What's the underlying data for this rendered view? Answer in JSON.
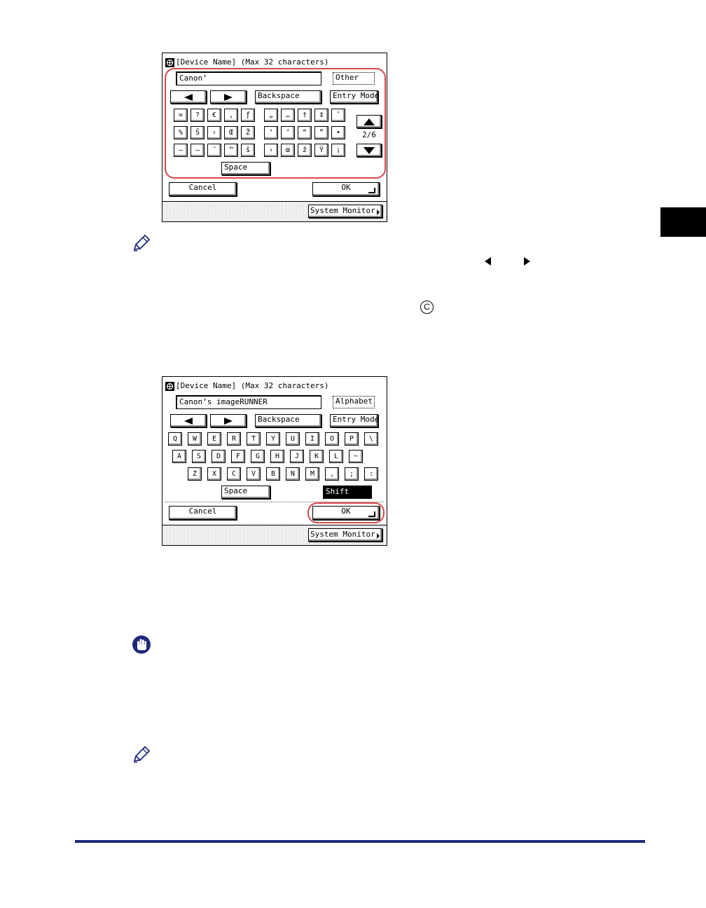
{
  "screen1": {
    "title": "[Device Name] (Max 32 characters)",
    "input_value": "Canon’",
    "mode_label": "Other",
    "backspace_label": "Backspace",
    "entry_mode_label": "Entry Mode",
    "page_indicator": "2/6",
    "keys_row1": [
      "=",
      "?",
      "€",
      ",",
      "ƒ",
      "„",
      "…",
      "†",
      "‡",
      "ˆ"
    ],
    "keys_row2": [
      "%",
      "Š",
      "‹",
      "Œ",
      "Ž",
      "‘",
      "’",
      "“",
      "”",
      "•"
    ],
    "keys_row3": [
      "–",
      "—",
      "˜",
      "™",
      "š",
      "›",
      "œ",
      "ž",
      "Ÿ",
      "¡"
    ],
    "space_label": "Space",
    "cancel_label": "Cancel",
    "ok_label": "OK",
    "system_monitor_label": "System Monitor"
  },
  "screen2": {
    "title": "[Device Name] (Max 32 characters)",
    "input_value": "Canon’s imageRUNNER",
    "mode_label": "Alphabet",
    "backspace_label": "Backspace",
    "entry_mode_label": "Entry Mode",
    "keys_row1": [
      "Q",
      "W",
      "E",
      "R",
      "T",
      "Y",
      "U",
      "I",
      "O",
      "P",
      "\\"
    ],
    "keys_row2": [
      "A",
      "S",
      "D",
      "F",
      "G",
      "H",
      "J",
      "K",
      "L",
      "~"
    ],
    "keys_row3": [
      "Z",
      "X",
      "C",
      "V",
      "B",
      "N",
      "M",
      ",",
      ";",
      ":"
    ],
    "space_label": "Space",
    "shift_label": "Shift",
    "cancel_label": "Cancel",
    "ok_label": "OK",
    "system_monitor_label": "System Monitor"
  },
  "icons": {
    "note": "pencil-icon",
    "important": "hand-stop-icon",
    "left_arrow": "triangle-left-icon",
    "right_arrow": "triangle-right-icon",
    "clear_key": "clear-c-icon",
    "scroll_up": "triangle-up-icon",
    "scroll_down": "triangle-down-icon"
  },
  "colors": {
    "highlight": "#d8474b",
    "footer_rule": "#1f2a7a",
    "icon_blue": "#1f2a7a"
  }
}
